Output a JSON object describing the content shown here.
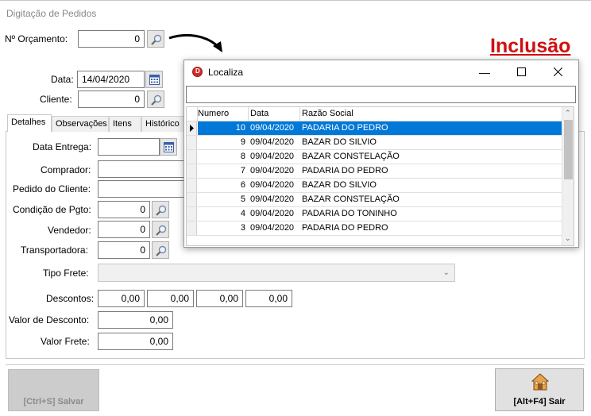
{
  "form": {
    "title": "Digitação de Pedidos",
    "mode_label": "Inclusão",
    "orcamento": {
      "label": "Nº Orçamento:",
      "value": "0"
    },
    "data": {
      "label": "Data:",
      "value": "14/04/2020"
    },
    "cliente": {
      "label": "Cliente:",
      "value": "0"
    }
  },
  "tabs": [
    "Detalhes",
    "Observações",
    "Itens",
    "Histórico"
  ],
  "detalhes": {
    "data_entrega": {
      "label": "Data Entrega:",
      "value": ""
    },
    "comprador": {
      "label": "Comprador:",
      "value": ""
    },
    "pedido_cliente": {
      "label": "Pedido do Cliente:",
      "value": ""
    },
    "condicao_pgto": {
      "label": "Condição de Pgto:",
      "value": "0"
    },
    "vendedor": {
      "label": "Vendedor:",
      "value": "0"
    },
    "transportadora": {
      "label": "Transportadora:",
      "value": "0"
    },
    "tipo_frete": {
      "label": "Tipo Frete:",
      "value": ""
    },
    "descontos": {
      "label": "Descontos:",
      "values": [
        "0,00",
        "0,00",
        "0,00",
        "0,00"
      ]
    },
    "valor_desconto": {
      "label": "Valor de Desconto:",
      "value": "0,00"
    },
    "valor_frete": {
      "label": "Valor Frete:",
      "value": "0,00"
    }
  },
  "buttons": {
    "salvar": "[Ctrl+S] Salvar",
    "sair": "[Alt+F4] Sair"
  },
  "dialog": {
    "title": "Localiza",
    "search_value": "",
    "columns": [
      "Numero",
      "Data",
      "Razão Social"
    ],
    "rows": [
      {
        "numero": "10",
        "data": "09/04/2020",
        "razao": "PADARIA DO PEDRO",
        "selected": true
      },
      {
        "numero": "9",
        "data": "09/04/2020",
        "razao": "BAZAR DO SILVIO"
      },
      {
        "numero": "8",
        "data": "09/04/2020",
        "razao": "BAZAR CONSTELAÇÃO"
      },
      {
        "numero": "7",
        "data": "09/04/2020",
        "razao": "PADARIA DO PEDRO"
      },
      {
        "numero": "6",
        "data": "09/04/2020",
        "razao": "BAZAR DO SILVIO"
      },
      {
        "numero": "5",
        "data": "09/04/2020",
        "razao": "BAZAR CONSTELAÇÃO"
      },
      {
        "numero": "4",
        "data": "09/04/2020",
        "razao": "PADARIA DO TONINHO"
      },
      {
        "numero": "3",
        "data": "09/04/2020",
        "razao": "PADARIA DO PEDRO"
      }
    ]
  },
  "colors": {
    "accent": "#0078d7",
    "mode_label": "#d01010"
  }
}
